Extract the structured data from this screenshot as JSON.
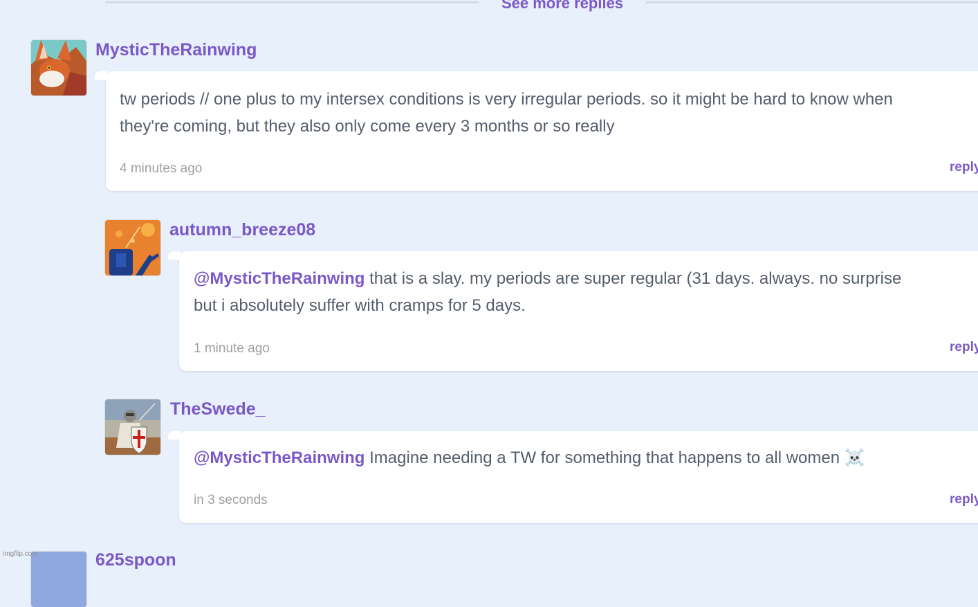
{
  "header": {
    "see_more_label": "See more replies"
  },
  "comments": [
    {
      "username": "MysticTheRainwing",
      "avatar": "fox-avatar",
      "mention": "",
      "line1": "tw periods // one plus to my intersex conditions is very irregular periods. so it might be hard to know when",
      "line2": "they're coming, but they also only come every 3 months or so really",
      "time": "4 minutes ago",
      "reply_label": "reply"
    },
    {
      "username": "autumn_breeze08",
      "avatar": "autumn-avatar",
      "mention": "@MysticTheRainwing",
      "line1": " that is a slay. my periods are super regular (31 days. always. no surprise",
      "line2": "but i absolutely suffer with cramps for 5 days.",
      "time": "1 minute ago",
      "reply_label": "reply"
    },
    {
      "username": "TheSwede_",
      "avatar": "knight-avatar",
      "mention": "@MysticTheRainwing",
      "line1": " Imagine needing a TW for something that happens to all women ☠️",
      "time": "in 3 seconds",
      "reply_label": "reply"
    },
    {
      "username": "625spoon",
      "avatar": "spoon-avatar"
    }
  ],
  "watermark": "imgflip.com",
  "colors": {
    "background": "#e8f0fb",
    "accent": "#7a58c7",
    "text": "#555d6b",
    "muted": "#a0a0a0",
    "card": "#ffffff"
  }
}
